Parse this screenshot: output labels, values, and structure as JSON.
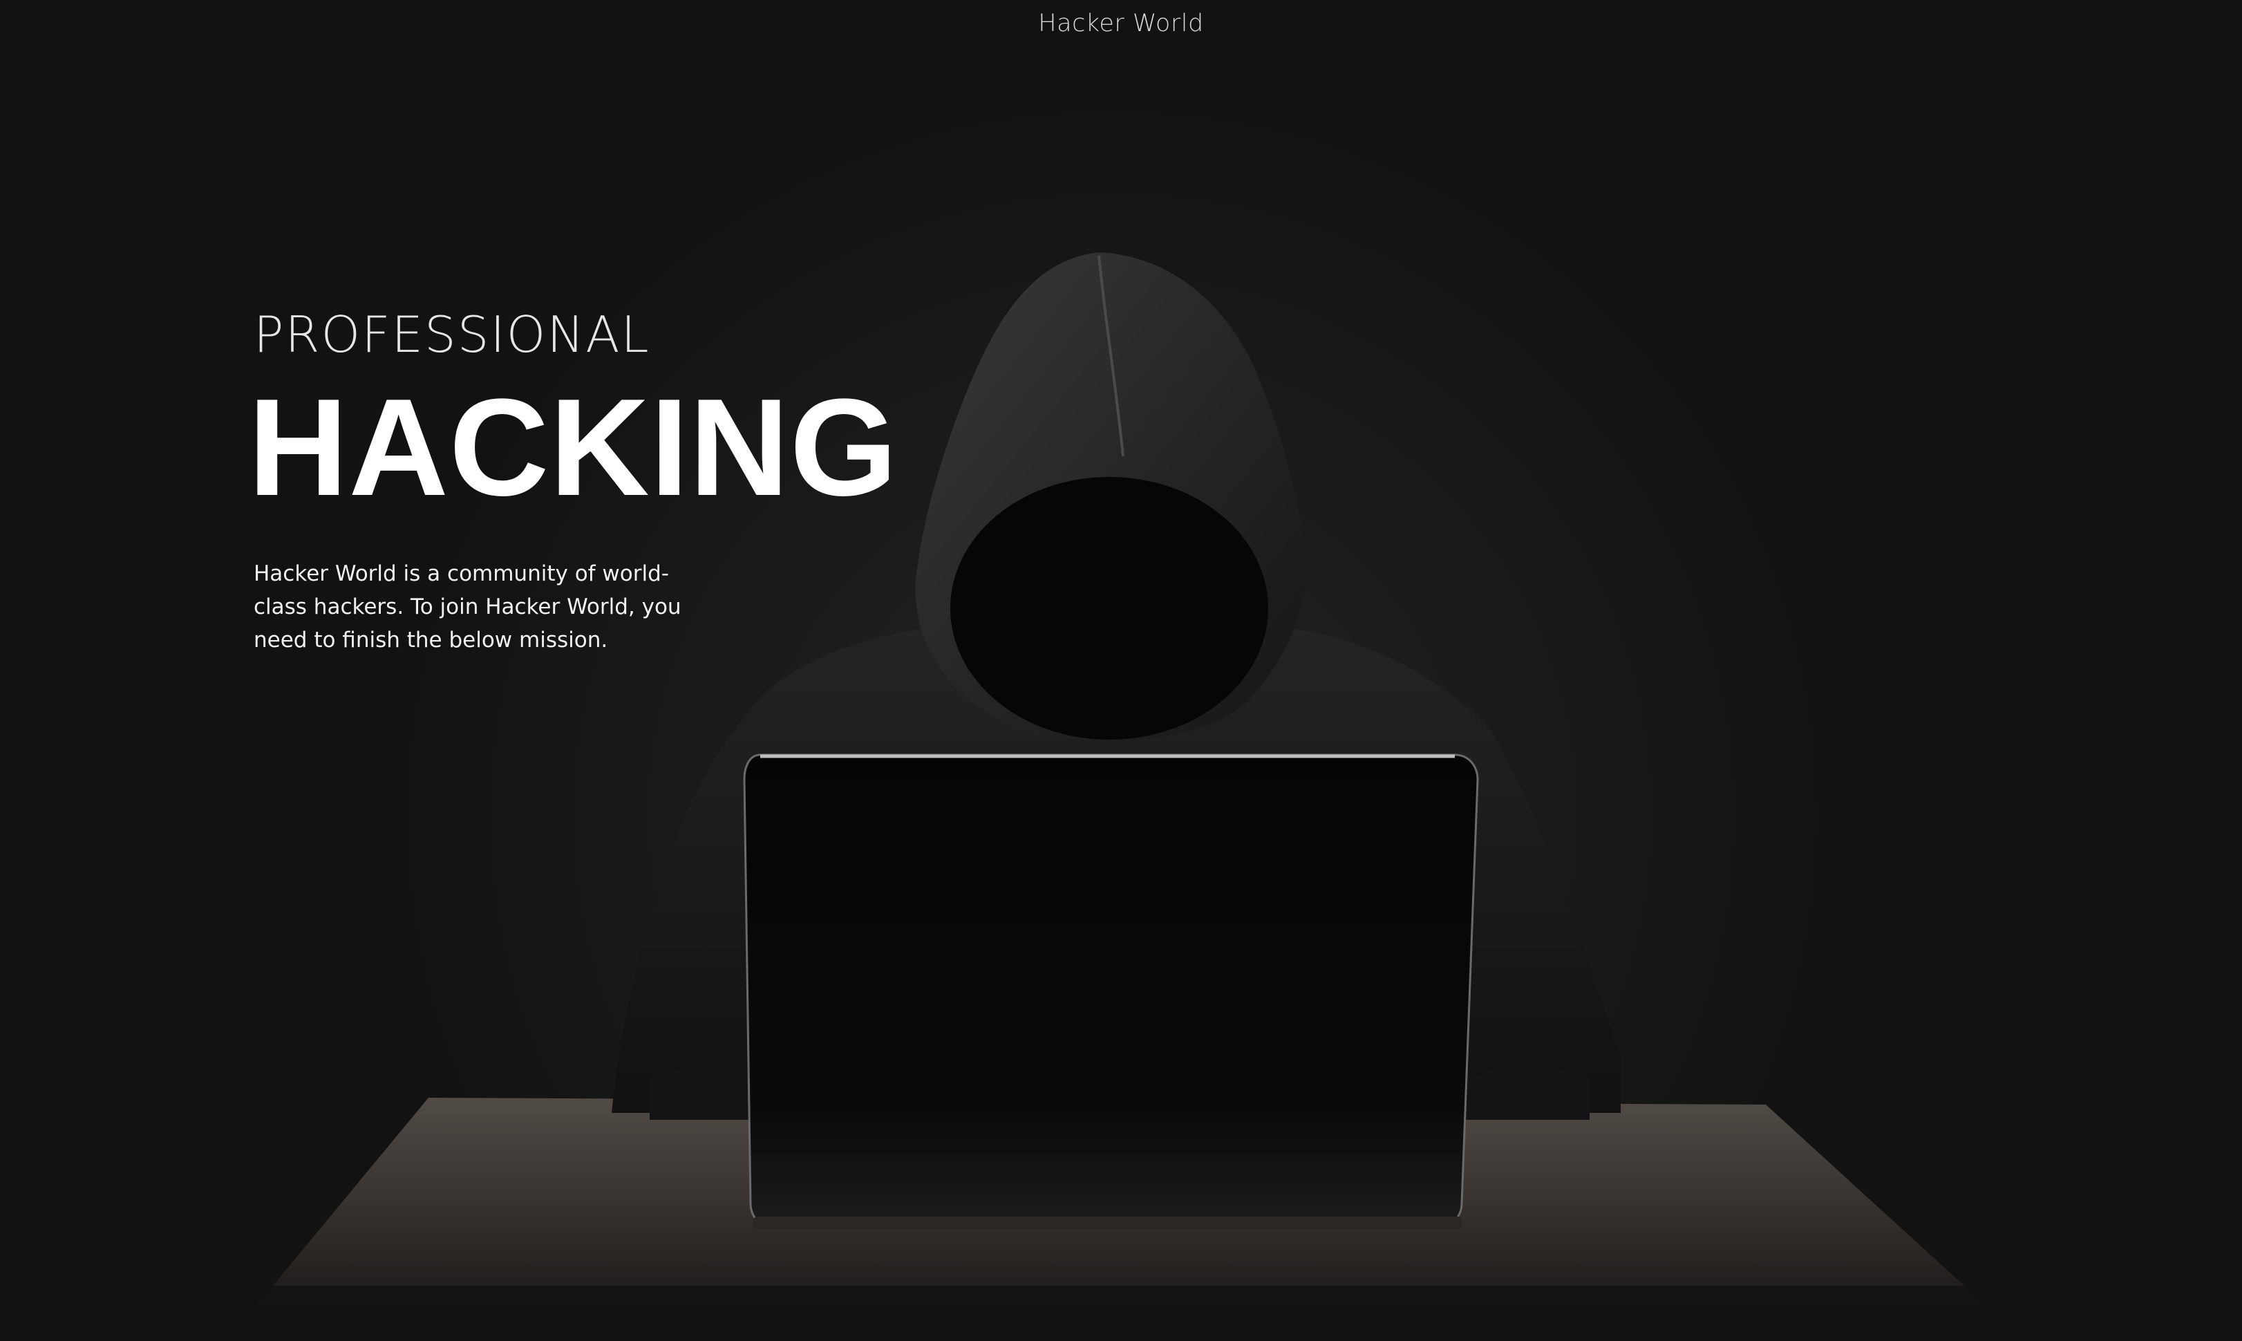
{
  "header": {
    "site_title": "Hacker World"
  },
  "hero": {
    "eyebrow": "PROFESSIONAL",
    "headline": "HACKING",
    "description": "Hacker World is a community of world-class hackers. To join Hacker World, you need to finish the below mission.",
    "image_icon": "hooded-hacker-with-laptop"
  },
  "colors": {
    "background": "#121212",
    "text_primary": "#ffffff",
    "text_muted": "#d8d8d8"
  }
}
